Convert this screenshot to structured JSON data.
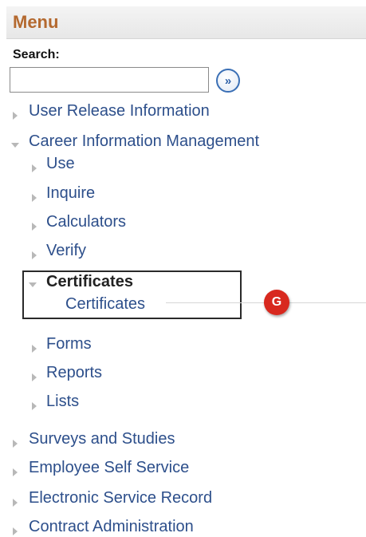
{
  "header": {
    "title": "Menu"
  },
  "search": {
    "label": "Search:",
    "value": "",
    "go_icon": "double-chevron-right-icon",
    "go_glyph": "»"
  },
  "menu": {
    "user_release": "User Release Information",
    "career_info": "Career Information Management",
    "use": "Use",
    "inquire": "Inquire",
    "calculators": "Calculators",
    "verify": "Verify",
    "certificates_folder": "Certificates",
    "certificates_link": "Certificates",
    "forms": "Forms",
    "reports": "Reports",
    "lists": "Lists",
    "surveys": "Surveys and Studies",
    "employee_self_service": "Employee Self Service",
    "electronic_service_record": "Electronic Service Record",
    "contract_admin": "Contract Administration"
  },
  "annotation": {
    "badge_letter": "G",
    "badge_color": "#d8291f"
  }
}
